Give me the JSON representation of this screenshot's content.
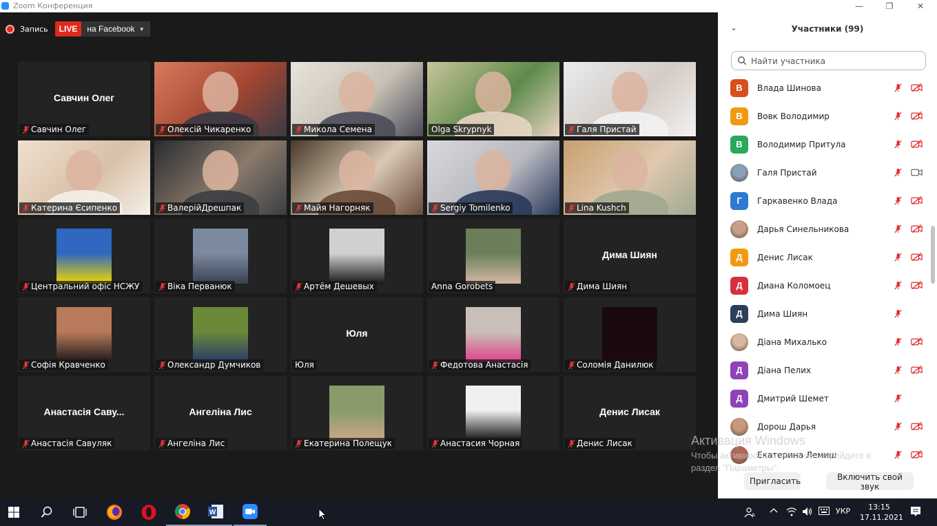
{
  "window": {
    "title": "Zoom Конференция",
    "controls": {
      "minimize": "—",
      "maximize": "❐",
      "close": "✕"
    }
  },
  "recording": {
    "label": "Запись",
    "live_badge": "LIVE",
    "live_target": "на Facebook"
  },
  "gallery": [
    {
      "name": "Савчин Олег",
      "big_name": "Савчин Олег",
      "muted": true,
      "type": "name"
    },
    {
      "name": "Олексій Чикаренко",
      "muted": true,
      "type": "video",
      "bg": [
        "#d97a5e",
        "#a24632",
        "#3a3a44"
      ]
    },
    {
      "name": "Микола Семена",
      "muted": true,
      "type": "video",
      "bg": [
        "#e8e4dc",
        "#c8c0b4",
        "#4a4c58"
      ]
    },
    {
      "name": "Olga Skrypnyk",
      "muted": false,
      "type": "video",
      "active": true,
      "bg": [
        "#c8c49a",
        "#5e8a4a",
        "#e8d4c4"
      ]
    },
    {
      "name": "Галя Пристай",
      "muted": true,
      "type": "video",
      "bg": [
        "#e8ecef",
        "#d4cbc4",
        "#f2f2f2"
      ]
    },
    {
      "name": "Катерина Єсипенко",
      "muted": true,
      "type": "video",
      "bg": [
        "#f0e0d0",
        "#d8c0a8",
        "#f4f0ea"
      ]
    },
    {
      "name": "ВалерійДрешпак",
      "muted": true,
      "type": "video",
      "bg": [
        "#2a2c30",
        "#8a7a6a",
        "#3c3e44"
      ]
    },
    {
      "name": "Майя Нагорняк",
      "muted": true,
      "type": "video",
      "bg": [
        "#4a3a2a",
        "#d8c8b4",
        "#6a4a3a"
      ]
    },
    {
      "name": "Sergiy Tomilenko",
      "muted": true,
      "type": "video",
      "bg": [
        "#d8d8dc",
        "#b8b8c0",
        "#2a3a5a"
      ]
    },
    {
      "name": "Lina Kushch",
      "muted": true,
      "type": "video",
      "bg": [
        "#c8a070",
        "#e0c8b0",
        "#a0a890"
      ]
    },
    {
      "name": "Центральний офіс НСЖУ",
      "muted": true,
      "type": "avatar",
      "avatar_colors": [
        "#2f67c1",
        "#f1d700"
      ]
    },
    {
      "name": "Віка Перванюк",
      "muted": true,
      "type": "avatar",
      "avatar_colors": [
        "#7c8aa0",
        "#3a4250"
      ]
    },
    {
      "name": "Артём Дешевых",
      "muted": true,
      "type": "avatar",
      "avatar_colors": [
        "#d0d0d0",
        "#1a1a1a"
      ]
    },
    {
      "name": "Anna Gorobets",
      "muted": false,
      "type": "avatar",
      "avatar_colors": [
        "#6b7f5a",
        "#d4b8a4"
      ]
    },
    {
      "name": "Дима Шиян",
      "big_name": "Дима Шиян",
      "muted": true,
      "type": "name"
    },
    {
      "name": "Софія Кравченко",
      "muted": true,
      "type": "avatar",
      "avatar_colors": [
        "#b87a5a",
        "#1a1a1a"
      ]
    },
    {
      "name": "Олександр Думчиков",
      "muted": true,
      "type": "avatar",
      "avatar_colors": [
        "#6a8a3a",
        "#2a3a6a"
      ]
    },
    {
      "name": "Юля",
      "big_name": "Юля",
      "muted": false,
      "type": "name"
    },
    {
      "name": "Федотова Анастасія",
      "muted": true,
      "type": "avatar",
      "avatar_colors": [
        "#c8c0b8",
        "#e0408a"
      ]
    },
    {
      "name": "Соломія Данилюк",
      "muted": true,
      "type": "avatar",
      "avatar_colors": [
        "#1a0a10",
        "#1a0a10"
      ]
    },
    {
      "name": "Анастасія Савуляк",
      "big_name": "Анастасія Саву...",
      "muted": true,
      "type": "name"
    },
    {
      "name": "Ангеліна Лис",
      "big_name": "Ангеліна Лис",
      "muted": true,
      "type": "name"
    },
    {
      "name": "Екатерина Полещук",
      "muted": true,
      "type": "avatar",
      "avatar_colors": [
        "#8a9a6a",
        "#c8a888"
      ]
    },
    {
      "name": "Анастасия Чорная",
      "muted": true,
      "type": "avatar",
      "avatar_colors": [
        "#f0f0f0",
        "#111111"
      ]
    },
    {
      "name": "Денис Лисак",
      "big_name": "Денис Лисак",
      "muted": true,
      "type": "name"
    }
  ],
  "participants_panel": {
    "title": "Участники (99)",
    "search_placeholder": "Найти участника",
    "items": [
      {
        "initial": "В",
        "color": "#d64f1c",
        "name": "Влада Шинова",
        "mic_muted": true,
        "video_off": true
      },
      {
        "initial": "В",
        "color": "#f09a12",
        "name": "Вовк Володимир",
        "mic_muted": true,
        "video_off": true
      },
      {
        "initial": "В",
        "color": "#2aa85c",
        "name": "Володимир Притула",
        "mic_muted": true,
        "video_off": true
      },
      {
        "initial": "",
        "color": "#8aa0b8",
        "name": "Галя Пристай",
        "photo": true,
        "mic_muted": true,
        "video_off": false
      },
      {
        "initial": "Г",
        "color": "#2e7ad1",
        "name": "Гаркавенко Влада",
        "mic_muted": true,
        "video_off": true
      },
      {
        "initial": "",
        "color": "#c8a08a",
        "name": "Дарья Синельникова",
        "photo": true,
        "mic_muted": true,
        "video_off": true
      },
      {
        "initial": "Д",
        "color": "#f09a12",
        "name": "Денис Лисак",
        "mic_muted": true,
        "video_off": true
      },
      {
        "initial": "Д",
        "color": "#d6303c",
        "name": "Диана Коломоец",
        "mic_muted": true,
        "video_off": true
      },
      {
        "initial": "Д",
        "color": "#2c3e5a",
        "name": "Дима Шиян",
        "mic_muted": true,
        "video_off": false,
        "no_video_icon": true
      },
      {
        "initial": "",
        "color": "#d8b8a0",
        "name": "Діана Михалько",
        "photo": true,
        "mic_muted": true,
        "video_off": true
      },
      {
        "initial": "Д",
        "color": "#8e44b8",
        "name": "Діана Пелих",
        "mic_muted": true,
        "video_off": true
      },
      {
        "initial": "Д",
        "color": "#8e44b8",
        "name": "Дмитрий Шемет",
        "mic_muted": true,
        "video_off": false,
        "no_video_icon": true
      },
      {
        "initial": "",
        "color": "#c89878",
        "name": "Дорош Дарья",
        "photo": true,
        "mic_muted": true,
        "video_off": true
      },
      {
        "initial": "",
        "color": "#b06a5a",
        "name": "Екатерина Лемиш",
        "photo": true,
        "mic_muted": true,
        "video_off": true
      }
    ],
    "invite_button": "Пригласить",
    "unmute_button": "Включить свой звук"
  },
  "watermark": {
    "line1": "Активация Windows",
    "line2": "Чтобы активировать Windows, перейдите в",
    "line3": "раздел \"Параметры\"."
  },
  "taskbar": {
    "apps": [
      "windows-start",
      "search",
      "task-view",
      "firefox",
      "opera",
      "chrome",
      "word",
      "zoom"
    ],
    "language": "УКР",
    "time": "13:15",
    "date": "17.11.2021"
  }
}
